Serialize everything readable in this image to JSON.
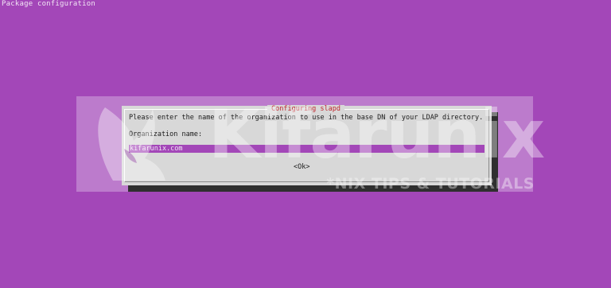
{
  "window": {
    "title": "Package configuration"
  },
  "dialog": {
    "title": "Configuring slapd",
    "prompt": "Please enter the name of the organization to use in the base DN of your LDAP directory.",
    "field_label": "Organization name:",
    "field_value": "kifarunix.com",
    "ok_label": "<Ok>"
  },
  "watermark": {
    "name": "Kifarunix",
    "tagline": "*NIX TIPS & TUTORIALS"
  },
  "colors": {
    "background": "#a347b8",
    "dialog": "#d8d8d8",
    "title": "#c1272d",
    "input_highlight": "#a347b8",
    "shadow": "#2f2f2f"
  }
}
